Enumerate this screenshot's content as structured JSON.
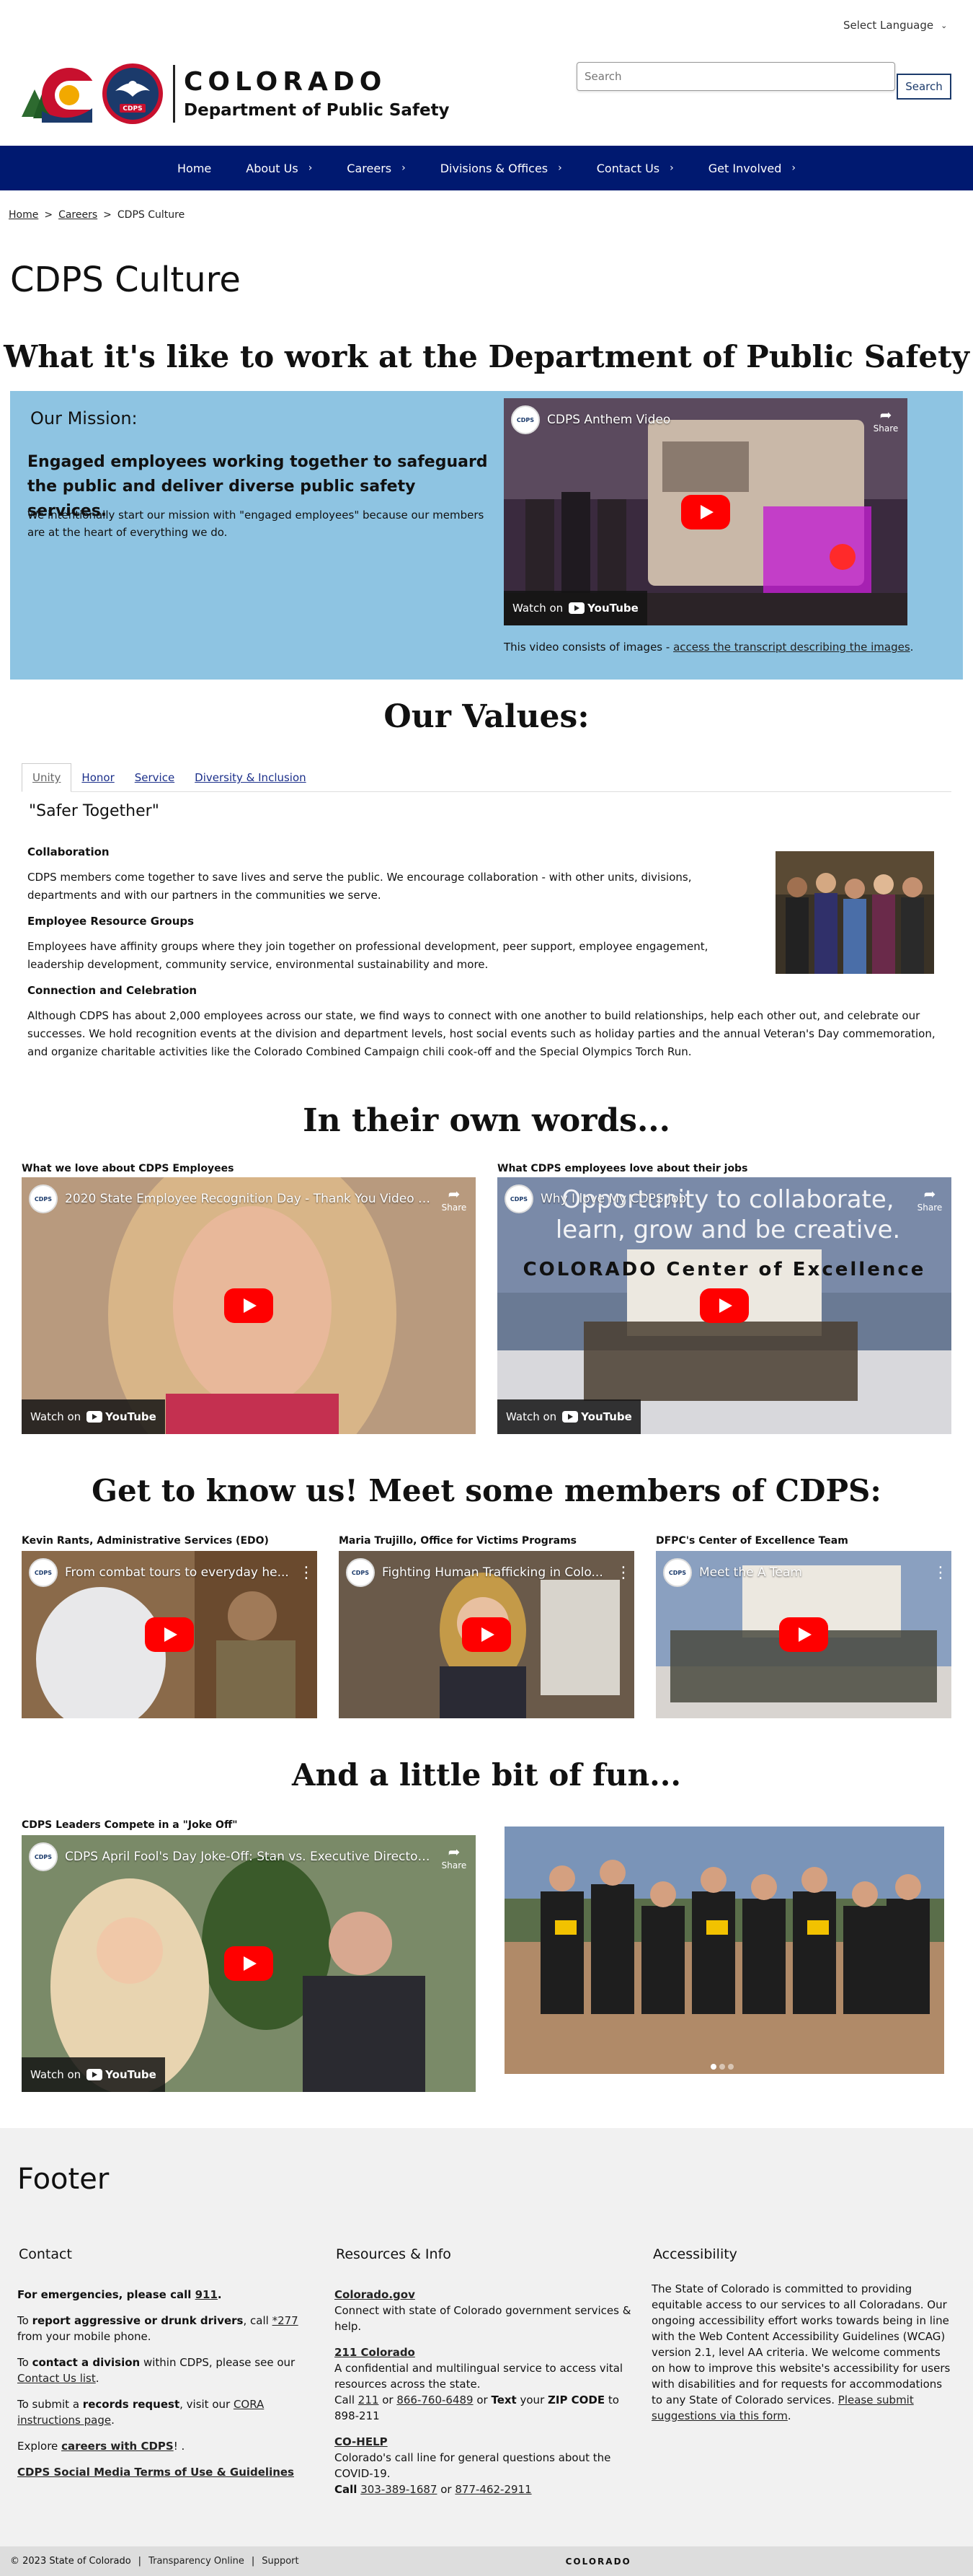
{
  "header": {
    "language_label": "Select Language",
    "logo_line1": "COLORADO",
    "logo_line2": "Department of Public Safety",
    "search_placeholder": "Search",
    "search_button": "Search",
    "logo_badge": "CDPS"
  },
  "nav": [
    {
      "label": "Home",
      "has_menu": false
    },
    {
      "label": "About Us",
      "has_menu": true
    },
    {
      "label": "Careers",
      "has_menu": true
    },
    {
      "label": "Divisions & Offices",
      "has_menu": true
    },
    {
      "label": "Contact Us",
      "has_menu": true
    },
    {
      "label": "Get Involved",
      "has_menu": true
    }
  ],
  "breadcrumb": {
    "home": "Home",
    "careers": "Careers",
    "current": "CDPS Culture"
  },
  "page_title": "CDPS Culture",
  "intro_heading": "What it's like to work at the Department of Public Safety",
  "mission": {
    "label": "Our Mission:",
    "headline": "Engaged employees working together to safeguard the public and deliver diverse public safety services.",
    "body": "We intentionally start our mission with \"engaged employees\" because our members are at the heart of everything we do.",
    "video_title": "CDPS Anthem Video",
    "caption_prefix": "This video consists of images - ",
    "caption_link": "access the transcript describing the images",
    "caption_suffix": "."
  },
  "values": {
    "heading": "Our Values:",
    "tabs": [
      "Unity",
      "Honor",
      "Service",
      "Diversity & Inclusion"
    ],
    "active_tab": "Unity",
    "quote": "\"Safer Together\"",
    "sections": [
      {
        "title": "Collaboration",
        "text": "CDPS members come together to save lives and serve the public. We encourage collaboration - with other units, divisions, departments and with our partners in the communities we serve."
      },
      {
        "title": "Employee Resource Groups",
        "text": "Employees have affinity groups where they join together on professional development, peer support, employee engagement, leadership development, community service, environmental sustainability and more."
      },
      {
        "title": "Connection and Celebration",
        "text": "Although CDPS has about 2,000 employees across our state, we find ways to connect with one another to build relationships, help each other out, and celebrate our successes. We hold recognition events at the division and department levels, host social events such as holiday parties and the annual Veteran's Day commemoration, and organize charitable activities like the Colorado Combined Campaign chili cook-off and the Special Olympics Torch Run."
      }
    ]
  },
  "own_words": {
    "heading": "In their own words...",
    "left_label": "What we love about CDPS Employees",
    "left_video": "2020 State Employee Recognition Day - Thank You Video to...",
    "right_label": "What CDPS employees love about their jobs",
    "right_video": "Why I love My CDPS Job",
    "right_overlay": "Opportunity to collaborate, learn, grow and be creative.",
    "right_sign": "COLORADO Center of Excellence"
  },
  "members": {
    "heading": "Get to know us! Meet some members of CDPS:",
    "items": [
      {
        "label": "Kevin Rants, Administrative Services (EDO)",
        "video": "From combat tours to everyday he..."
      },
      {
        "label": "Maria Trujillo, Office for Victims Programs",
        "video": "Fighting Human Trafficking in Colo..."
      },
      {
        "label": "DFPC's Center of Excellence Team",
        "video": "Meet the A Team"
      }
    ]
  },
  "fun": {
    "heading": "And a little bit of fun...",
    "label": "CDPS Leaders Compete in a \"Joke Off\"",
    "video": "CDPS April Fool's Day Joke-Off: Stan vs. Executive Director'..."
  },
  "video_common": {
    "watch_on": "Watch on",
    "youtube": "YouTube",
    "share": "Share"
  },
  "footer": {
    "title": "Footer",
    "contact": {
      "heading": "Contact",
      "emergency_prefix": "For emergencies, please call ",
      "emergency_link": "911",
      "emergency_suffix": ".",
      "drunk_prefix": "To ",
      "drunk_bold": "report aggressive or drunk drivers",
      "drunk_mid": ", call ",
      "drunk_link": "*277",
      "drunk_suffix": " from your mobile phone.",
      "division_prefix": "To ",
      "division_bold": "contact a division",
      "division_mid": " within CDPS, please see our ",
      "division_link": "Contact Us list",
      "division_suffix": ".",
      "records_prefix": "To submit a ",
      "records_bold": "records request",
      "records_mid": ", visit our ",
      "records_link": "CORA instructions page",
      "records_suffix": ".",
      "explore_prefix": "Explore ",
      "explore_link": "careers with CDPS",
      "explore_suffix": "! .",
      "social_link": "CDPS Social Media Terms of Use & Guidelines"
    },
    "resources": {
      "heading": "Resources & Info",
      "gov_link": "Colorado.gov",
      "gov_text": "Connect with state of Colorado government services & help.",
      "r211_link": "211 Colorado",
      "r211_text": "A confidential and multilingual service to access vital resources across the state.",
      "r211_call": "Call ",
      "r211_num1": "211",
      "r211_or": " or ",
      "r211_num2": "866-760-6489",
      "r211_or_text": " or ",
      "r211_text_bold": "Text",
      "r211_your": " your ",
      "r211_zip": "ZIP CODE",
      "r211_to": " to 898-211",
      "cohelp_link": "CO-HELP",
      "cohelp_text": "Colorado's call line for general questions about the COVID-19.",
      "cohelp_call": "Call",
      "cohelp_num1": "303-389-1687",
      "cohelp_or": " or ",
      "cohelp_num2": "877-462-2911"
    },
    "accessibility": {
      "heading": "Accessibility",
      "text": "The State of Colorado is committed to providing equitable access to our services to all Coloradans. Our ongoing accessibility effort works towards being in line with the Web Content Accessibility Guidelines (WCAG) version 2.1, level AA criteria. We welcome comments on how to improve this website's accessibility for users with disabilities and for requests for accommodations to any State of Colorado services. ",
      "link": "Please submit suggestions via this form",
      "suffix": "."
    },
    "bottom": {
      "copyright": "© 2023 State of Colorado",
      "transparency": "Transparency Online",
      "support": "Support",
      "logo": "COLORADO"
    }
  },
  "colors": {
    "nav_bg": "#001970",
    "mission_bg": "#8ec4e2",
    "footer_bg": "#f1f1f1",
    "yt_red": "#ff0000"
  }
}
